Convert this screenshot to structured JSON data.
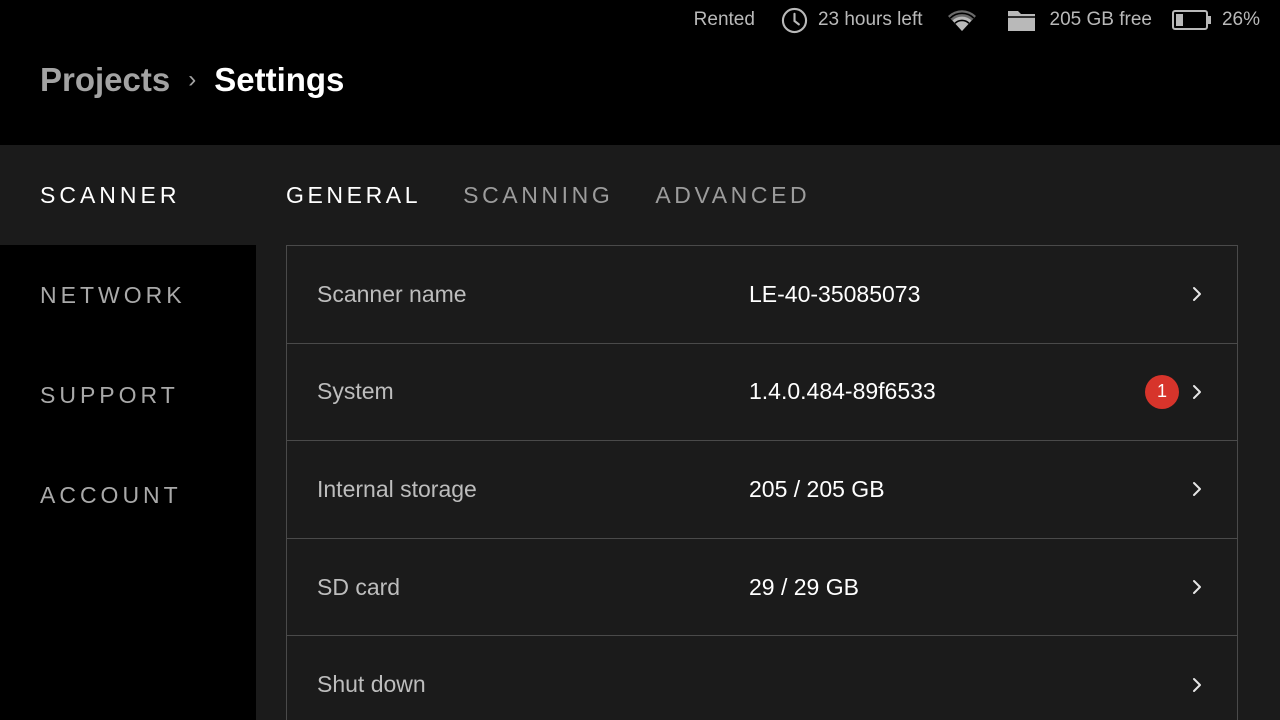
{
  "status": {
    "rental_label": "Rented",
    "time_left": "23 hours left",
    "storage_free": "205 GB free",
    "battery_percent": "26%",
    "battery_level": 0.26
  },
  "breadcrumb": {
    "parent": "Projects",
    "separator": "›",
    "current": "Settings"
  },
  "sidebar": {
    "items": [
      {
        "label": "SCANNER",
        "active": true
      },
      {
        "label": "NETWORK",
        "active": false
      },
      {
        "label": "SUPPORT",
        "active": false
      },
      {
        "label": "ACCOUNT",
        "active": false
      }
    ]
  },
  "tabs": [
    {
      "label": "GENERAL",
      "active": true
    },
    {
      "label": "SCANNING",
      "active": false
    },
    {
      "label": "ADVANCED",
      "active": false
    }
  ],
  "settings": {
    "rows": [
      {
        "label": "Scanner name",
        "value": "LE-40-35085073"
      },
      {
        "label": "System",
        "value": "1.4.0.484-89f6533",
        "badge": "1"
      },
      {
        "label": "Internal storage",
        "value": "205 / 205 GB"
      },
      {
        "label": "SD card",
        "value": "29 / 29 GB"
      },
      {
        "label": "Shut down",
        "value": ""
      }
    ]
  },
  "colors": {
    "background": "#000000",
    "panel": "#1b1b1b",
    "border": "#4a4a4a",
    "badge": "#d7342b",
    "text_primary": "#ffffff",
    "text_muted": "#a9a9a9"
  },
  "icons": {
    "clock": "clock-icon",
    "wifi": "wifi-icon",
    "folder": "folder-icon",
    "battery": "battery-icon",
    "chevron": "chevron-right-icon"
  }
}
